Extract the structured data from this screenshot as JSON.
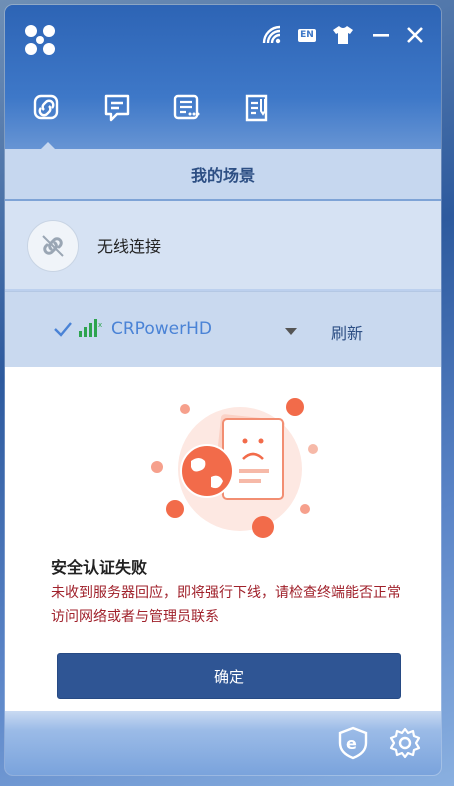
{
  "titlebar": {
    "logo": "app-logo",
    "lang_badge": "EN",
    "icons": [
      "wifi-signal-icon",
      "language-icon",
      "skin-shirt-icon",
      "minimize-icon",
      "close-icon"
    ]
  },
  "tabs": [
    {
      "icon": "link-icon",
      "active": true
    },
    {
      "icon": "message-icon",
      "active": false
    },
    {
      "icon": "list-icon",
      "active": false
    },
    {
      "icon": "notes-icon",
      "active": false
    }
  ],
  "section_title": "我的场景",
  "connection": {
    "label": "无线连接",
    "icon": "broken-link-icon"
  },
  "wifi": {
    "ssid": "CRPowerHD",
    "refresh_label": "刷新",
    "connected": true
  },
  "dialog": {
    "title": "安全认证失败",
    "message": "未收到服务器回应，即将强行下线，请检查终端能否正常访问网络或者与管理员联系",
    "ok_label": "确定",
    "illustration": "sad-document-globe-illustration"
  },
  "footer": {
    "icons": [
      "shield-e-icon",
      "settings-gear-icon"
    ]
  },
  "colors": {
    "accent": "#2f5594",
    "error_text": "#a0212b",
    "ssid_text": "#4a83d6"
  }
}
